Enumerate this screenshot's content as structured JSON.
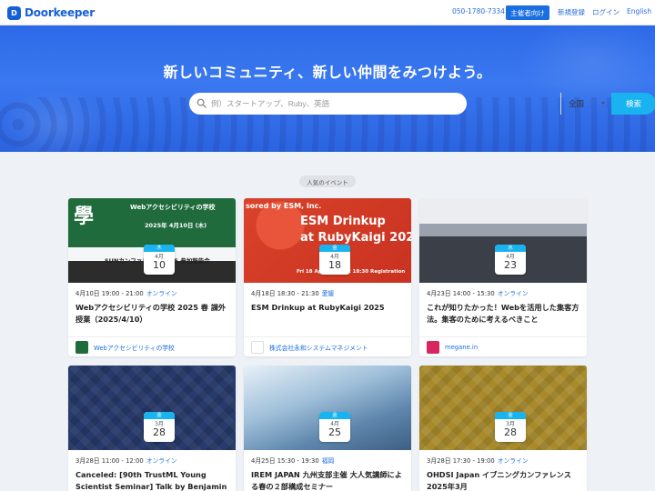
{
  "brand": {
    "name": "Doorkeeper",
    "mark": "D"
  },
  "nav": {
    "phone": "050-1780-7334",
    "organizer": "主催者向け",
    "signup": "新規登録",
    "login": "ログイン",
    "language": "English"
  },
  "hero": {
    "title": "新しいコミュニティ、新しい仲間をみつけよう。",
    "search_placeholder": "例）スタートアップ、Ruby、英語",
    "region": "全国",
    "search_button": "検索"
  },
  "section": {
    "label": "人気のイベント"
  },
  "events": [
    {
      "image_title": "Webアクセシビリティの学校",
      "image_sub": "SUNカンファレンス 2025 参加報告会",
      "image_date": "2025年 4月10日 (木)",
      "image_kanji": "學",
      "badge": {
        "dow": "木",
        "month": "4月",
        "day": "10"
      },
      "datetime": "4月10日 19:00 - 21:00",
      "location": "オンライン",
      "title": "Webアクセシビリティの学校 2025 春 課外授業（2025/4/10）",
      "group": "Webアクセシビリティの学校",
      "group_color": "#1f6b3c"
    },
    {
      "image_title": "ESM Drinkup",
      "image_sub": "at RubyKaigi 2025",
      "image_date": "Fri 18 April 2025 at 18:30 Registration",
      "image_kanji": "sored by ESM, Inc.",
      "badge": {
        "dow": "金",
        "month": "4月",
        "day": "18"
      },
      "datetime": "4月18日 18:30 - 21:30",
      "location": "愛媛",
      "title": "ESM Drinkup at RubyKaigi 2025",
      "group": "株式会社永和システムマネジメント",
      "group_color": "#ffffff"
    },
    {
      "image_title": "",
      "image_sub": "",
      "image_date": "",
      "image_kanji": "",
      "badge": {
        "dow": "水",
        "month": "4月",
        "day": "23"
      },
      "datetime": "4月23日 14:00 - 15:30",
      "location": "オンライン",
      "title": "これが知りたかった！Webを活用した集客方法。集客のために考えるべきこと",
      "group": "megane.in",
      "group_color": "#d8265f"
    },
    {
      "image_title": "",
      "image_sub": "",
      "image_date": "",
      "image_kanji": "",
      "badge": {
        "dow": "金",
        "month": "3月",
        "day": "28"
      },
      "datetime": "3月28日 11:00 - 12:00",
      "location": "オンライン",
      "title": "Canceled: [90th TrustML Young Scientist Seminar] Talk by Benjamin",
      "group": "",
      "group_color": "#273a6b"
    },
    {
      "image_title": "",
      "image_sub": "",
      "image_date": "",
      "image_kanji": "",
      "badge": {
        "dow": "金",
        "month": "4月",
        "day": "25"
      },
      "datetime": "4月25日 15:30 - 19:30",
      "location": "福岡",
      "title": "IREM JAPAN 九州支部主催 大人気講師による春の２部構成セミナー",
      "group": "",
      "group_color": "#3e5f82"
    },
    {
      "image_title": "",
      "image_sub": "",
      "image_date": "",
      "image_kanji": "",
      "badge": {
        "dow": "金",
        "month": "3月",
        "day": "28"
      },
      "datetime": "3月28日 17:30 - 19:00",
      "location": "オンライン",
      "title": "OHDSI Japan イブニングカンファレンス 2025年3月",
      "group": "",
      "group_color": "#a88a2a"
    }
  ]
}
